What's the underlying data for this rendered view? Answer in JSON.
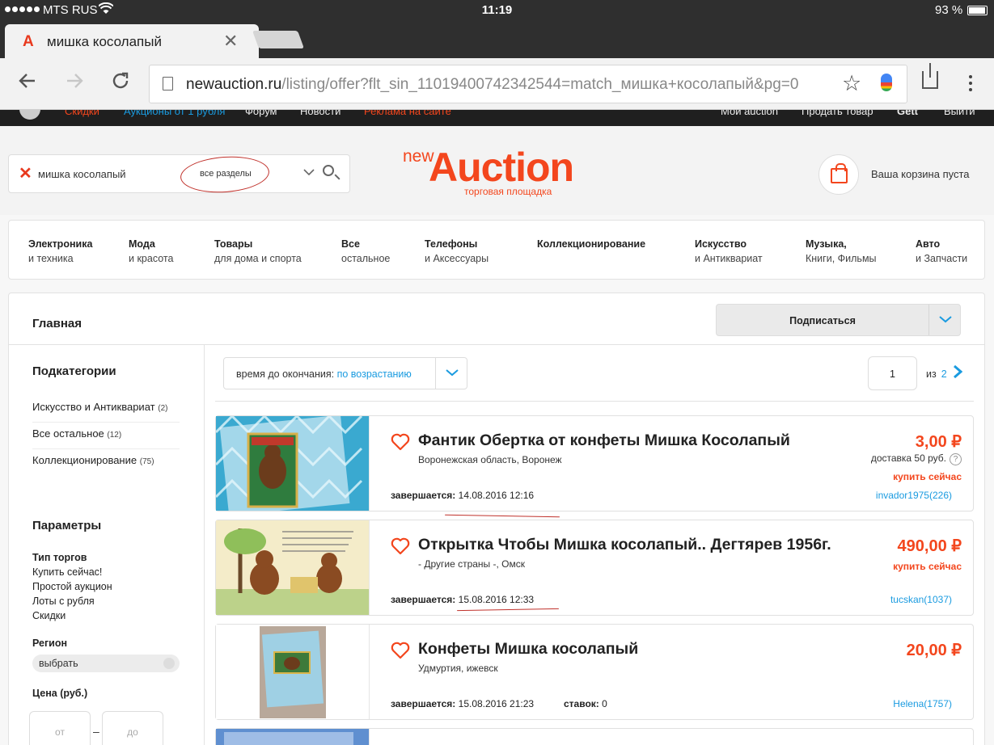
{
  "status_bar": {
    "carrier": "MTS RUS",
    "time": "11:19",
    "battery": "93 %"
  },
  "browser": {
    "tab_title": "мишка косолапый",
    "favicon_letter": "A",
    "url_host": "newauction.ru",
    "url_path": "/listing/offer?flt_sin_11019400742342544=match_мишка+косолапый&pg=0"
  },
  "site_nav": {
    "items": [
      "Скидки",
      "Аукционы от 1 рубля",
      "Форум",
      "Новости",
      "Реклама на сайте"
    ],
    "right_items": [
      "Мой auction",
      "Продать товар",
      "Gett",
      "Выйти"
    ]
  },
  "header": {
    "search_value": "мишка косолапый",
    "search_section": "все разделы",
    "brand_new": "new",
    "brand_main": "Auction",
    "brand_sub": "торговая площадка",
    "cart_text": "Ваша корзина пуста"
  },
  "categories": [
    {
      "title": "Электроника",
      "sub": "и техника"
    },
    {
      "title": "Мода",
      "sub": "и красота"
    },
    {
      "title": "Товары",
      "sub": "для дома и спорта"
    },
    {
      "title": "Все",
      "sub": "остальное"
    },
    {
      "title": "Телефоны",
      "sub": "и Аксессуары"
    },
    {
      "title": "Коллекционирование",
      "sub": ""
    },
    {
      "title": "Искусство",
      "sub": "и Антиквариат"
    },
    {
      "title": "Музыка,",
      "sub": "Книги, Фильмы"
    },
    {
      "title": "Авто",
      "sub": "и Запчасти"
    }
  ],
  "main": {
    "title": "Главная",
    "subscribe": "Подписаться",
    "sort_label": "время до окончания:",
    "sort_value": "по возрастанию",
    "page_current": "1",
    "page_of": "из",
    "page_total": "2"
  },
  "sidebar": {
    "subcats_title": "Подкатегории",
    "subcats": [
      {
        "label": "Искусство и Антиквариат",
        "count": "(2)"
      },
      {
        "label": "Все остальное",
        "count": "(12)"
      },
      {
        "label": "Коллекционирование",
        "count": "(75)"
      }
    ],
    "params_title": "Параметры",
    "trade_type_title": "Тип торгов",
    "trade_types": [
      "Купить сейчас!",
      "Простой аукцион",
      "Лоты с рубля",
      "Скидки"
    ],
    "region_title": "Регион",
    "region_value": "выбрать",
    "price_title": "Цена (руб.)",
    "price_from": "от",
    "price_to": "до"
  },
  "listings": [
    {
      "title": "Фантик Обертка от конфеты Мишка Косолапый",
      "location": "Воронежская область, Воронеж",
      "ends_label": "завершается:",
      "ends_value": "14.08.2016 12:16",
      "price": "3,00 ₽",
      "delivery": "доставка 50 руб.",
      "buy_now": "купить сейчас",
      "seller": "invador1975(226)"
    },
    {
      "title": "Открытка Чтобы Мишка косолапый.. Дегтярев 1956г.",
      "location": "- Другие страны -, Омск",
      "ends_label": "завершается:",
      "ends_value": "15.08.2016 12:33",
      "price": "490,00 ₽",
      "buy_now": "купить сейчас",
      "seller": "tucskan(1037)"
    },
    {
      "title": "Конфеты Мишка косолапый",
      "location": "Удмуртия, ижевск",
      "ends_label": "завершается:",
      "ends_value": "15.08.2016 21:23",
      "bids_label": "ставок:",
      "bids_value": "0",
      "price": "20,00 ₽",
      "seller": "Helena(1757)"
    }
  ],
  "colors": {
    "brand": "#f3461d",
    "link": "#1a9be0",
    "annotation": "#c0312b"
  }
}
